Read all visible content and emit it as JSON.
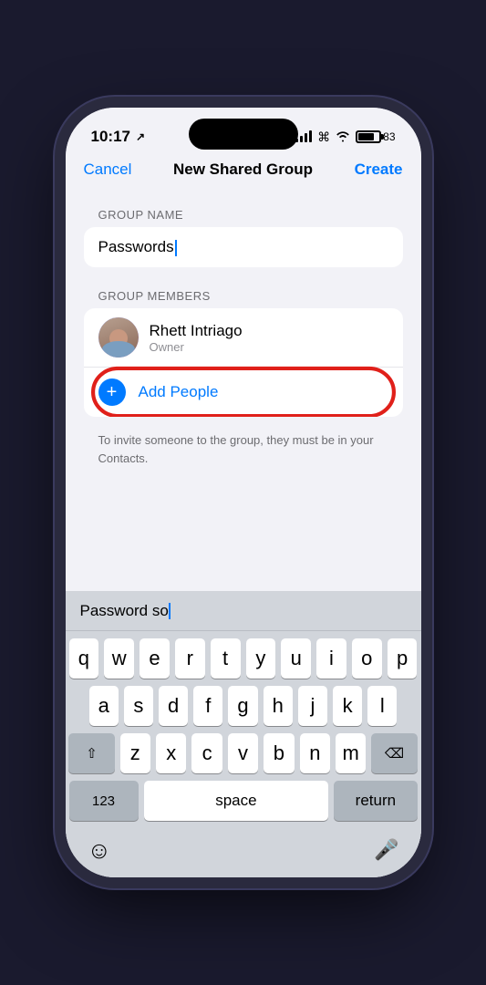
{
  "statusBar": {
    "time": "10:17",
    "battery": "83"
  },
  "navBar": {
    "cancel": "Cancel",
    "title": "New Shared Group",
    "create": "Create"
  },
  "form": {
    "groupNameLabel": "GROUP NAME",
    "groupNameValue": "Passwords",
    "groupMembersLabel": "GROUP MEMBERS"
  },
  "member": {
    "name": "Rhett Intriago",
    "role": "Owner"
  },
  "addPeople": {
    "label": "Add People"
  },
  "hint": {
    "text": "To invite someone to the group, they must be in your Contacts."
  },
  "keyboard": {
    "predictive": "Password so",
    "row1": [
      "q",
      "w",
      "e",
      "r",
      "t",
      "y",
      "u",
      "i",
      "o",
      "p"
    ],
    "row2": [
      "a",
      "s",
      "d",
      "f",
      "g",
      "h",
      "j",
      "k",
      "l"
    ],
    "row3": [
      "z",
      "x",
      "c",
      "v",
      "b",
      "n",
      "m"
    ],
    "numbers": "123",
    "space": "space",
    "return": "return"
  }
}
